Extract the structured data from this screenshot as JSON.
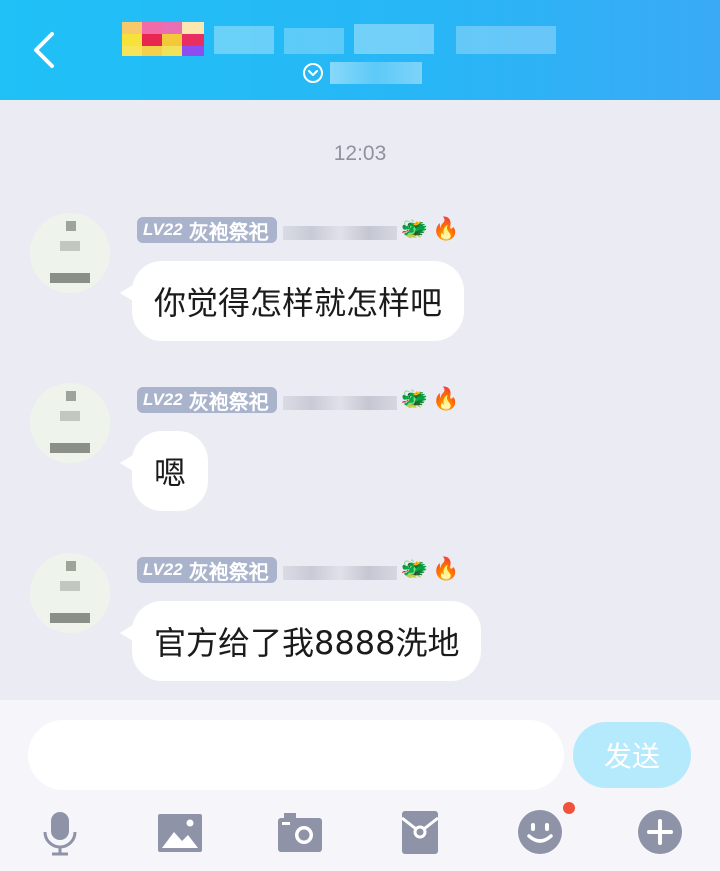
{
  "header": {
    "back_icon": "chevron-left-icon",
    "title": "",
    "subtitle": "",
    "background": "#28b6f6"
  },
  "chat": {
    "timestamp": "12:03",
    "messages": [
      {
        "level": "LV22",
        "title": "灰袍祭祀",
        "emojis": [
          "🐲",
          "🔥"
        ],
        "text": "你觉得怎样就怎样吧"
      },
      {
        "level": "LV22",
        "title": "灰袍祭祀",
        "emojis": [
          "🐲",
          "🔥"
        ],
        "text": "嗯"
      },
      {
        "level": "LV22",
        "title": "灰袍祭祀",
        "emojis": [
          "🐲",
          "🔥"
        ],
        "text": "官方给了我8888洗地"
      }
    ]
  },
  "input_bar": {
    "message_value": "",
    "send_label": "发送",
    "send_color": "#b5e9fc",
    "tools": [
      "microphone-icon",
      "image-icon",
      "camera-icon",
      "red-packet-icon",
      "emoji-icon",
      "plus-icon"
    ],
    "notification_color": "#f0533c"
  }
}
